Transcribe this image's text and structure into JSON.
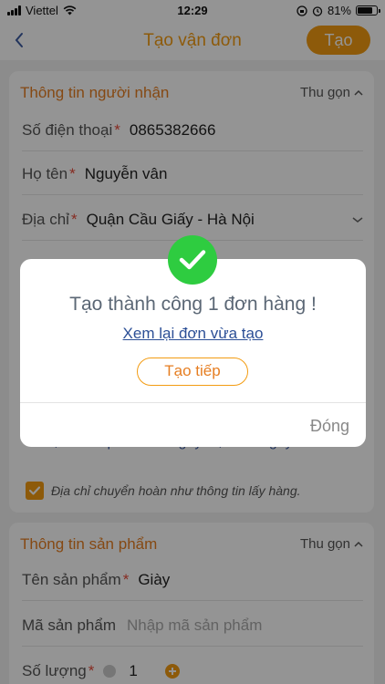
{
  "status_bar": {
    "carrier": "Viettel",
    "time": "12:29",
    "battery": "81%",
    "battery_level": 0.81
  },
  "nav": {
    "title": "Tạo vận đơn",
    "create_label": "Tạo"
  },
  "receiver": {
    "header": "Thông tin người nhận",
    "collapse_label": "Thu gọn",
    "phone_label": "Số điện thoại",
    "phone_value": "0865382666",
    "name_label": "Họ tên",
    "name_value": "Nguyễn vân",
    "address_label": "Địa chỉ",
    "address_value": "Quận Cầu Giấy - Hà Nội",
    "return_address": "Tỉnh, Thành phố Thái Nguyên, Thái Nguyên",
    "same_address_label": "Địa chỉ chuyển hoàn như thông tin lấy hàng."
  },
  "product": {
    "header": "Thông tin sản phẩm",
    "collapse_label": "Thu gọn",
    "name_label": "Tên sản phẩm",
    "name_value": "Giày",
    "code_label": "Mã sản phẩm",
    "code_placeholder": "Nhập mã sản phẩm",
    "qty_label": "Số lượng",
    "qty_value": "1"
  },
  "modal": {
    "message": "Tạo thành công 1 đơn hàng !",
    "review_link": "Xem lại đơn vừa tạo",
    "continue_label": "Tạo tiếp",
    "close_label": "Đóng"
  },
  "colors": {
    "accent": "#f39c12",
    "success": "#2ecc40",
    "link": "#2c4f96"
  }
}
